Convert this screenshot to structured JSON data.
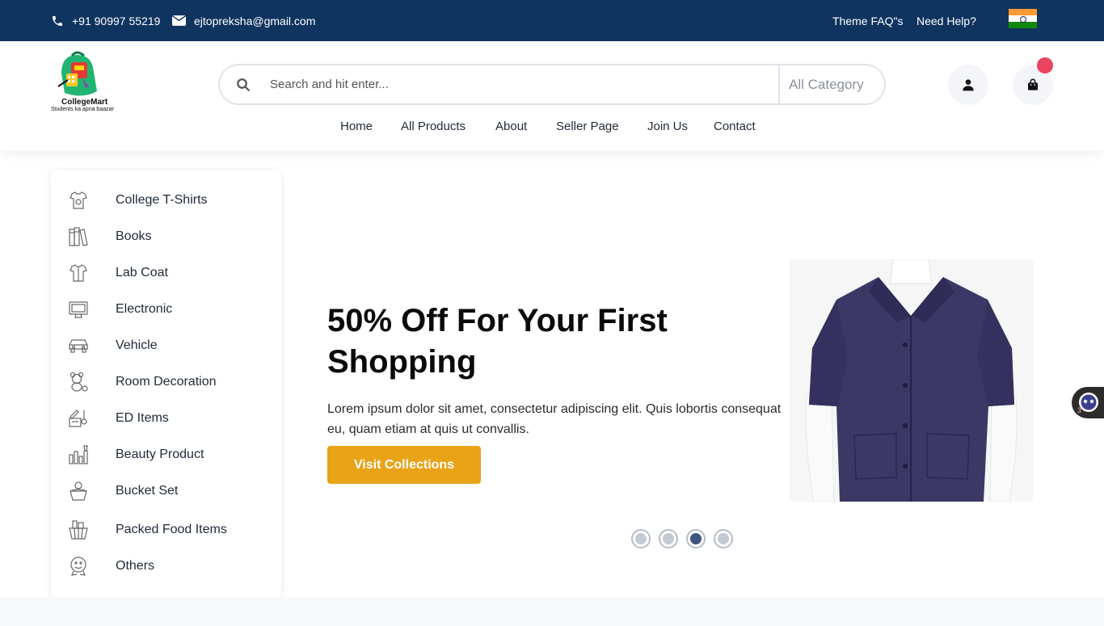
{
  "topbar": {
    "phone": "+91 90997 55219",
    "email": "ejtopreksha@gmail.com",
    "theme_faq": "Theme FAQ\"s",
    "need_help": "Need Help?"
  },
  "header": {
    "logo_title": "CollegeMart",
    "logo_tagline": "Students ka apna baazar",
    "search_placeholder": "Search and hit enter...",
    "category_select": "All Category",
    "nav": [
      "Home",
      "All Products",
      "About",
      "Seller Page",
      "Join Us",
      "Contact"
    ]
  },
  "sidebar": {
    "categories": [
      {
        "label": "College T-Shirts",
        "icon": "tshirt-icon"
      },
      {
        "label": "Books",
        "icon": "books-icon"
      },
      {
        "label": "Lab Coat",
        "icon": "labcoat-icon"
      },
      {
        "label": "Electronic",
        "icon": "monitor-icon"
      },
      {
        "label": "Vehicle",
        "icon": "car-icon"
      },
      {
        "label": "Room Decoration",
        "icon": "teddy-bear-icon"
      },
      {
        "label": "ED Items",
        "icon": "drafting-tools-icon"
      },
      {
        "label": "Beauty Product",
        "icon": "cosmetics-icon"
      },
      {
        "label": "Bucket Set",
        "icon": "bucket-icon"
      },
      {
        "label": "Packed Food Items",
        "icon": "food-basket-icon"
      },
      {
        "label": "Others",
        "icon": "toy-icon"
      }
    ]
  },
  "hero": {
    "title": "50% Off For Your First Shopping",
    "description": "Lorem ipsum dolor sit amet, consectetur adipiscing elit. Quis lobortis consequat eu, quam etiam at quis ut convallis.",
    "button_label": "Visit Collections",
    "image_alt": "Navy blue lab coat on mannequin",
    "slides_count": 4,
    "active_slide": 3
  },
  "chat_widget": {
    "unread_count": "3"
  },
  "colors": {
    "topbar_bg": "#0f3460",
    "accent": "#e8a317",
    "badge": "#e94560",
    "active_dot": "#3d5682"
  }
}
